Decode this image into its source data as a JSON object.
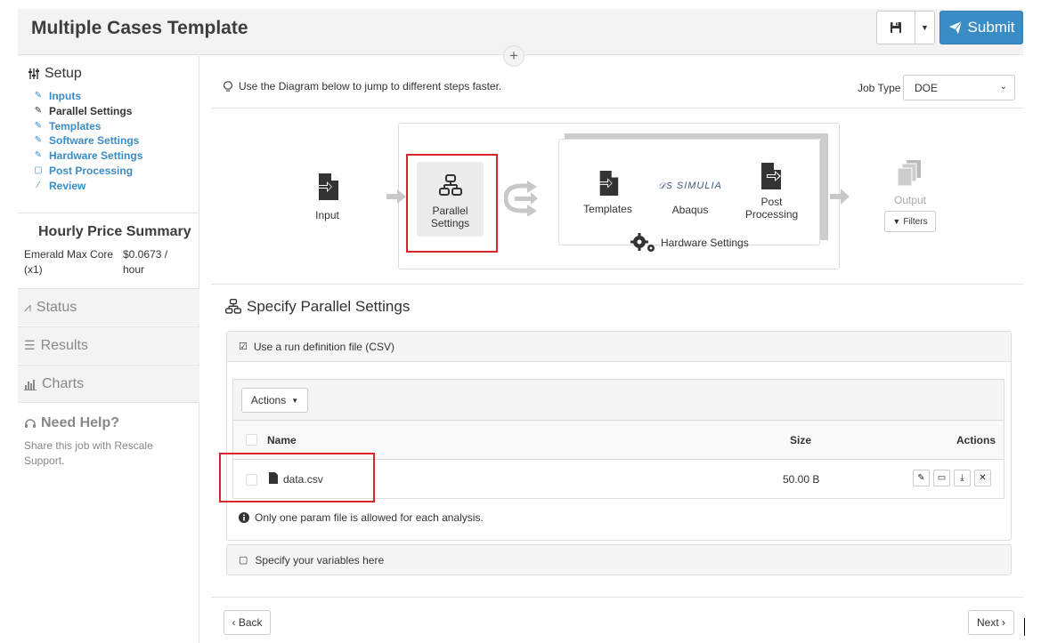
{
  "header": {
    "title": "Multiple Cases Template",
    "submit_label": "Submit",
    "plus": "+"
  },
  "sidebar": {
    "setup_label": "Setup",
    "setup_items": [
      {
        "label": "Inputs",
        "icon": "edit-icon"
      },
      {
        "label": "Parallel Settings",
        "icon": "edit-icon",
        "active": true
      },
      {
        "label": "Templates",
        "icon": "edit-icon"
      },
      {
        "label": "Software Settings",
        "icon": "edit-icon"
      },
      {
        "label": "Hardware Settings",
        "icon": "edit-icon"
      },
      {
        "label": "Post Processing",
        "icon": "square-icon"
      },
      {
        "label": "Review",
        "icon": "magic-wand-icon"
      }
    ],
    "price_title": "Hourly Price Summary",
    "price_name": "Emerald Max Core (x1)",
    "price_value": "$0.0673 / hour",
    "status_label": "Status",
    "results_label": "Results",
    "charts_label": "Charts",
    "help_title": "Need Help?",
    "help_text": "Share this job with Rescale Support."
  },
  "main": {
    "tip": "Use the Diagram below to jump to different steps faster.",
    "job_type_label": "Job Type",
    "job_type_value": "DOE",
    "diagram": {
      "input": "Input",
      "parallel_line1": "Parallel",
      "parallel_line2": "Settings",
      "templates": "Templates",
      "simulia": "SIMULIA",
      "abaqus": "Abaqus",
      "post_line1": "Post",
      "post_line2": "Processing",
      "hardware": "Hardware Settings",
      "output": "Output",
      "filters": "Filters"
    },
    "section_title": "Specify Parallel Settings",
    "csv_panel_label": "Use a run definition file (CSV)",
    "actions_label": "Actions",
    "table": {
      "col_name": "Name",
      "col_size": "Size",
      "col_actions": "Actions",
      "rows": [
        {
          "name": "data.csv",
          "size": "50.00 B"
        }
      ]
    },
    "note": "Only one param file is allowed for each analysis.",
    "variables_label": "Specify your variables here",
    "back_label": "‹ Back",
    "next_label": "Next ›"
  },
  "colors": {
    "accent": "#3a8cc4",
    "highlight": "#d9262c"
  }
}
